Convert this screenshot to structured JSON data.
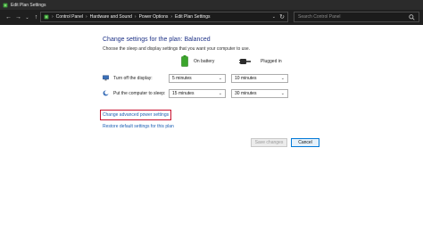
{
  "window": {
    "title": "Edit Plan Settings"
  },
  "address_bar": {
    "crumbs": [
      "Control Panel",
      "Hardware and Sound",
      "Power Options",
      "Edit Plan Settings"
    ]
  },
  "search": {
    "placeholder": "Search Control Panel"
  },
  "main": {
    "heading": "Change settings for the plan: Balanced",
    "subheading": "Choose the sleep and display settings that you want your computer to use.",
    "columns": {
      "battery": "On battery",
      "plugged": "Plugged in"
    },
    "rows": [
      {
        "label": "Turn off the display:",
        "battery": "5 minutes",
        "plugged": "10 minutes"
      },
      {
        "label": "Put the computer to sleep:",
        "battery": "15 minutes",
        "plugged": "30 minutes"
      }
    ],
    "advanced_link": "Change advanced power settings",
    "restore_link": "Restore default settings for this plan"
  },
  "buttons": {
    "save": "Save changes",
    "cancel": "Cancel"
  },
  "colors": {
    "heading": "#1e3287",
    "link": "#1b5fb4",
    "highlight": "#c8102e",
    "battery": "#3aa52b"
  }
}
